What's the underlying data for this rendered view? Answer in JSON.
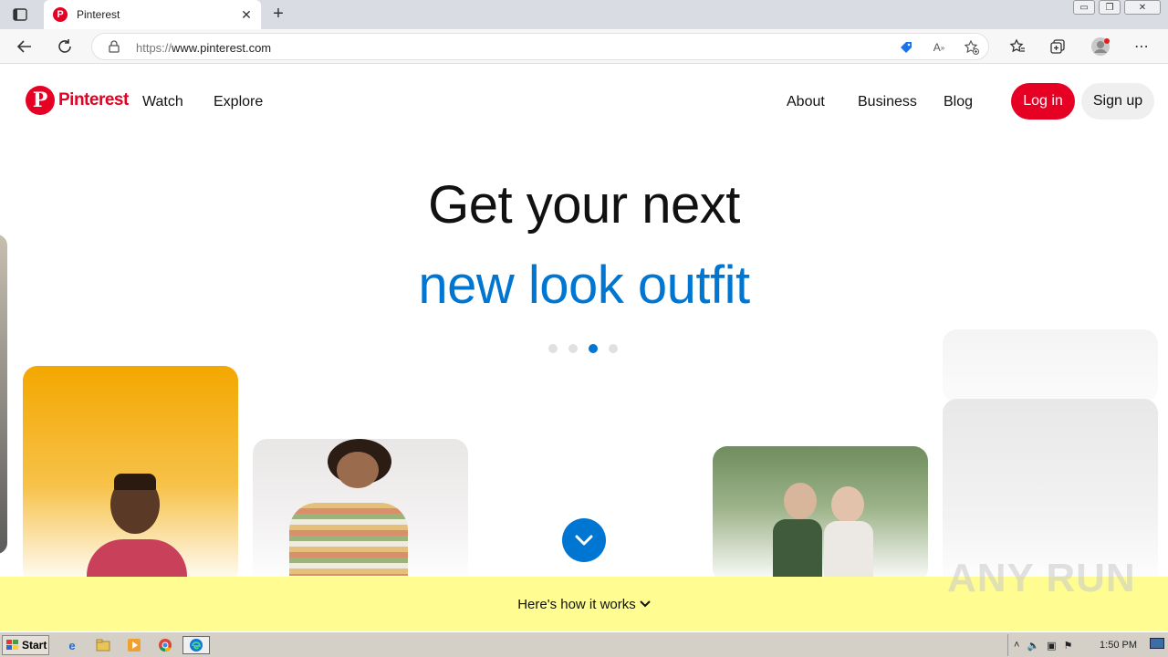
{
  "browser": {
    "tab_title": "Pinterest",
    "tab_favicon": "P",
    "url_scheme": "https://",
    "url_host": "www.pinterest.com",
    "window_buttons": {
      "minimize": "▭",
      "restore": "❐",
      "close": "✕"
    }
  },
  "site": {
    "brand_name": "Pinterest",
    "brand_letter": "P",
    "nav_left": [
      "Watch",
      "Explore"
    ],
    "nav_right": [
      "About",
      "Business",
      "Blog"
    ],
    "login_label": "Log in",
    "signup_label": "Sign up",
    "headline_line1": "Get your next",
    "headline_line2": "new look outfit",
    "carousel_dots": 4,
    "carousel_active_index": 2,
    "how_it_works_label": "Here's how it works",
    "colors": {
      "brand": "#e60023",
      "accent": "#0076d3",
      "banner": "#fffd92"
    }
  },
  "watermark": "ANY RUN",
  "taskbar": {
    "start_label": "Start",
    "clock": "1:50 PM"
  }
}
